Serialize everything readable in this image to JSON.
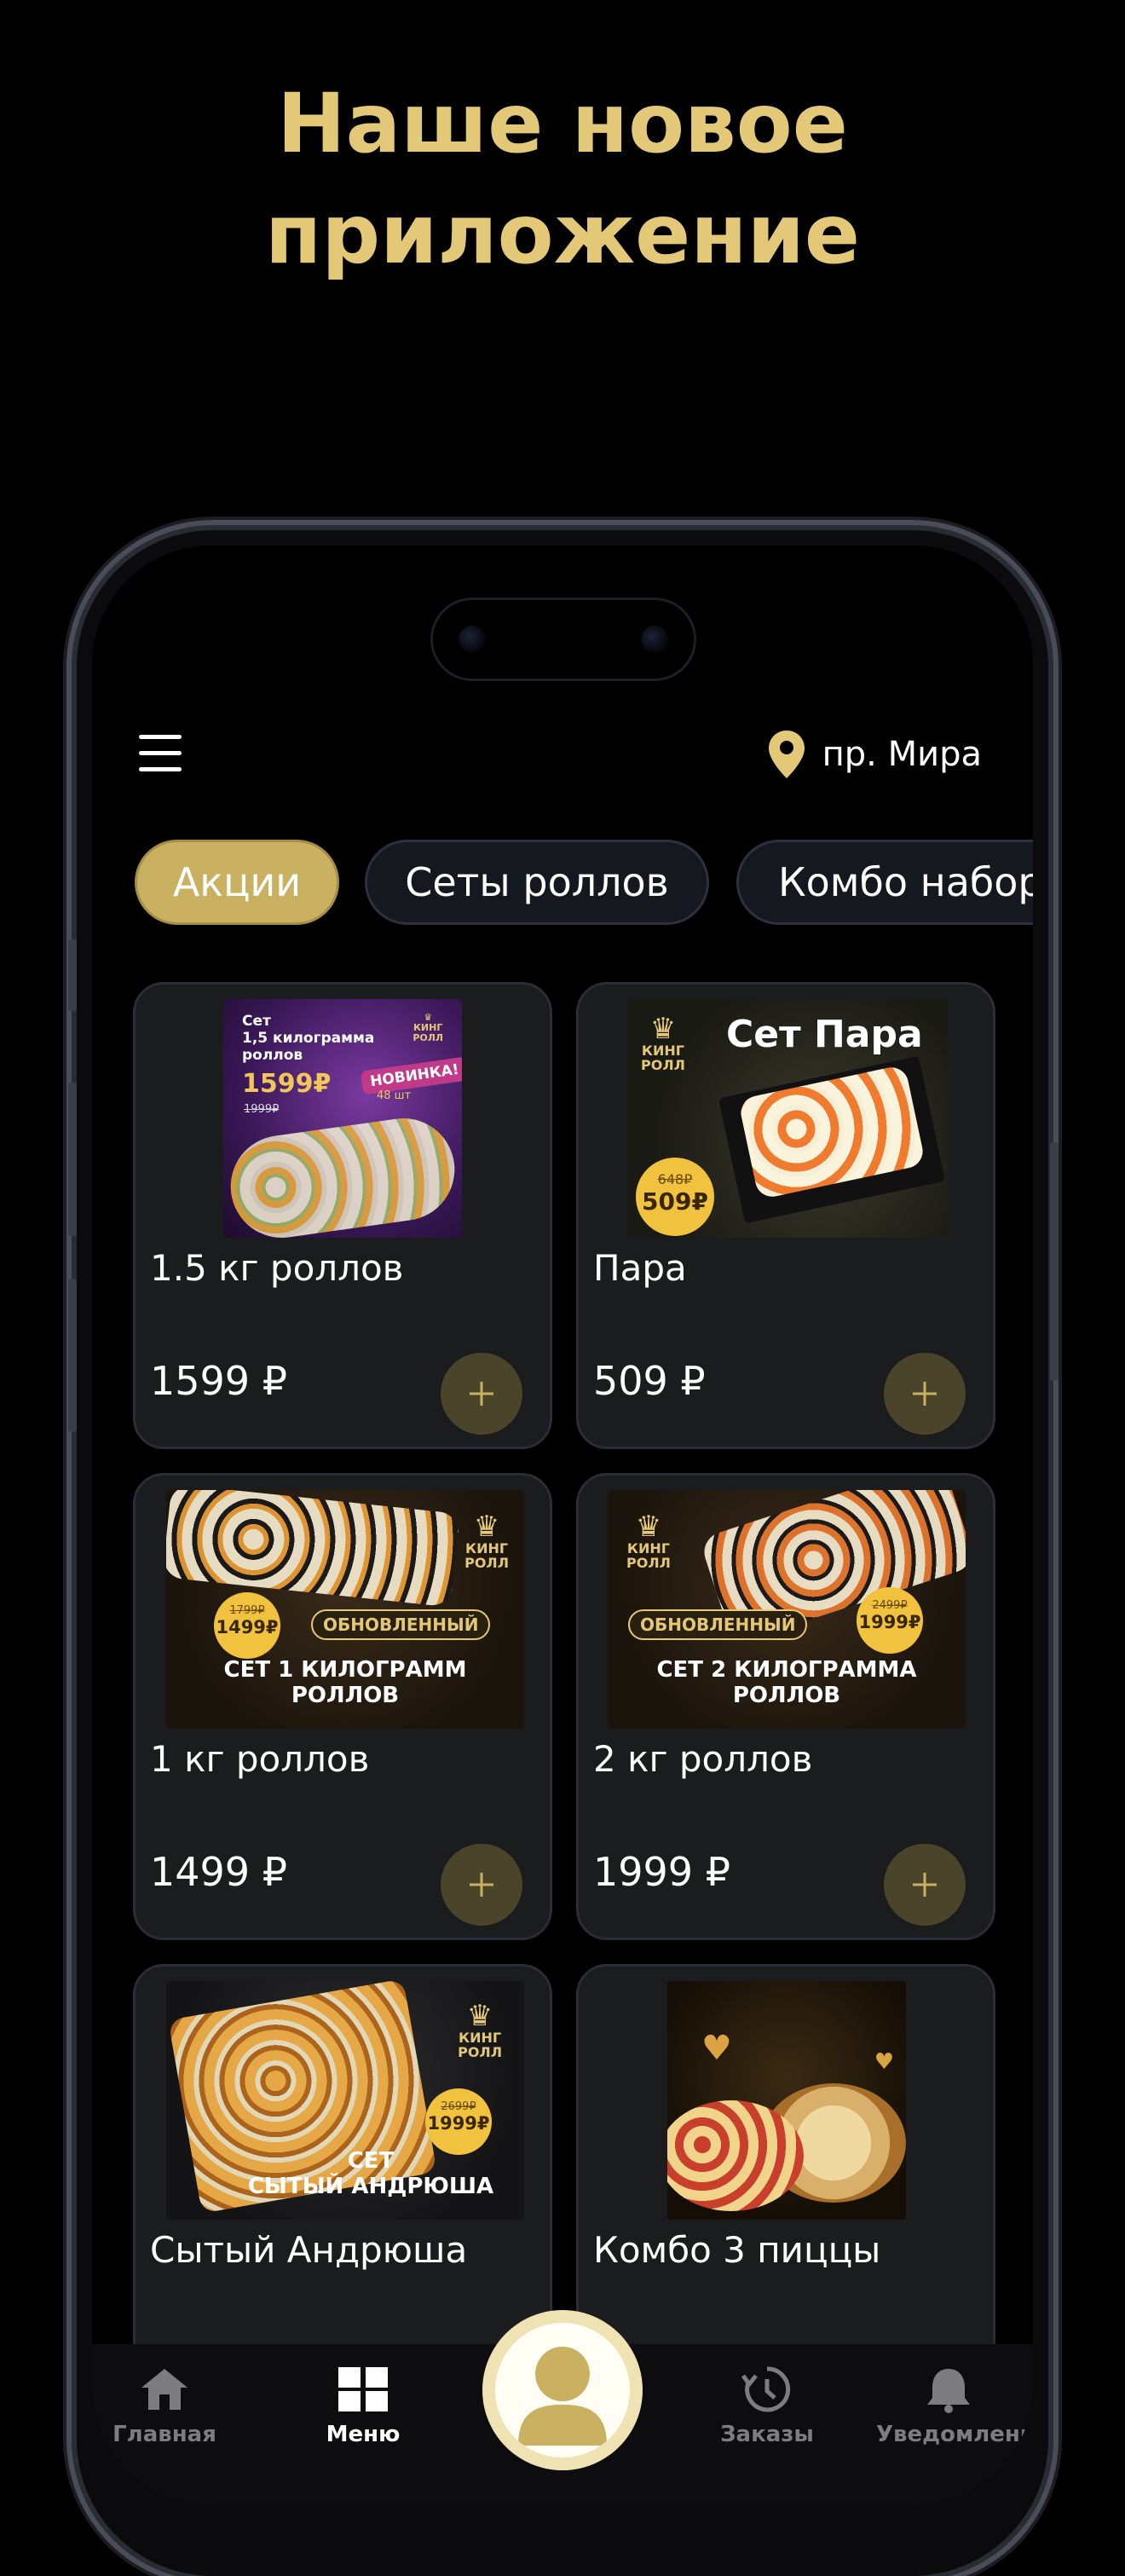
{
  "promo": {
    "headline_line1": "Наше новое",
    "headline_line2": "приложение"
  },
  "header": {
    "menu_icon": "hamburger-icon",
    "location_icon": "map-pin-icon",
    "location_label": "пр. Мира"
  },
  "categories": [
    {
      "label": "Акции",
      "active": true
    },
    {
      "label": "Сеты роллов",
      "active": false
    },
    {
      "label": "Комбо набор",
      "active": false
    }
  ],
  "products": [
    {
      "name": "1.5 кг роллов",
      "price": "1599 ₽",
      "image": {
        "line1": "Сет",
        "line2": "1,5 килограмма",
        "line3": "роллов",
        "price_new": "1599₽",
        "price_old": "1999₽",
        "badge": "НОВИНКА!",
        "badge_sub": "48 шт",
        "brand1": "КИНГ",
        "brand2": "РОЛЛ"
      }
    },
    {
      "name": "Пара",
      "price": "509 ₽",
      "image": {
        "title": "Сет Пара",
        "brand1": "КИНГ",
        "brand2": "РОЛЛ",
        "price_old": "648₽",
        "price_new": "509₽"
      }
    },
    {
      "name": "1 кг роллов",
      "price": "1499 ₽",
      "image": {
        "brand1": "КИНГ",
        "brand2": "РОЛЛ",
        "price_old": "1799₽",
        "price_new": "1499₽",
        "ribbon": "ОБНОВЛЕННЫЙ",
        "title1": "СЕТ 1 КИЛОГРАММ",
        "title2": "РОЛЛОВ"
      }
    },
    {
      "name": "2 кг роллов",
      "price": "1999 ₽",
      "image": {
        "brand1": "КИНГ",
        "brand2": "РОЛЛ",
        "price_old": "2499₽",
        "price_new": "1999₽",
        "ribbon": "ОБНОВЛЕННЫЙ",
        "title1": "СЕТ 2 КИЛОГРАММА",
        "title2": "РОЛЛОВ"
      }
    },
    {
      "name": "Сытый Андрюша",
      "price": "",
      "image": {
        "brand1": "КИНГ",
        "brand2": "РОЛЛ",
        "price_old": "2699₽",
        "price_new": "1999₽",
        "title1": "СЕТ",
        "title2": "СЫТЫЙ АНДРЮША"
      }
    },
    {
      "name": "Комбо 3 пиццы",
      "price": "",
      "image": {}
    }
  ],
  "tabs": [
    {
      "label": "Главная",
      "icon": "home-icon",
      "active": false
    },
    {
      "label": "Меню",
      "icon": "grid-icon",
      "active": true
    },
    {
      "label": "Заказы",
      "icon": "history-icon",
      "active": false
    },
    {
      "label": "Уведомления",
      "icon": "bell-icon",
      "active": false
    }
  ],
  "profile_button": {
    "icon": "user-avatar-icon"
  },
  "colors": {
    "accent_gold": "#e3c878",
    "chip_active": "#c9b161",
    "add_button": "#4a442a",
    "card_bg": "#1b1c1e",
    "background": "#000000"
  }
}
